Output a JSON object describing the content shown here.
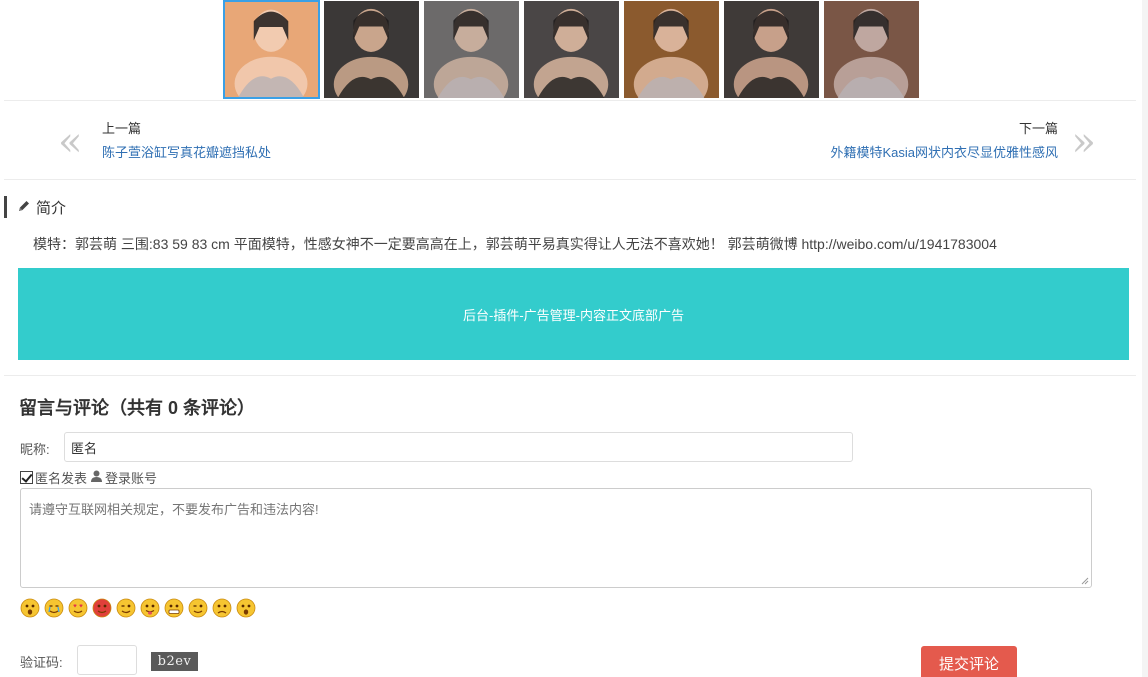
{
  "gallery": {
    "thumbnails": [
      {
        "alt": "photo-1",
        "bg": "#e8a777",
        "accent": "#f2cbb0",
        "active": true
      },
      {
        "alt": "photo-2",
        "bg": "#3b3837",
        "accent": "#c9a58c",
        "active": false
      },
      {
        "alt": "photo-3",
        "bg": "#6c6a6a",
        "accent": "#c7ad9c",
        "active": false
      },
      {
        "alt": "photo-4",
        "bg": "#4a4646",
        "accent": "#cfae98",
        "active": false
      },
      {
        "alt": "photo-5",
        "bg": "#8b5a2e",
        "accent": "#d9b299",
        "active": false
      },
      {
        "alt": "photo-6",
        "bg": "#3f3a38",
        "accent": "#c7a08a",
        "active": false
      },
      {
        "alt": "photo-7",
        "bg": "#7a5646",
        "accent": "#bfa7a0",
        "active": false
      }
    ]
  },
  "nav": {
    "prev_label": "上一篇",
    "prev_title": "陈子萱浴缸写真花瓣遮挡私处",
    "next_label": "下一篇",
    "next_title": "外籍模特Kasia网状内衣尽显优雅性感风",
    "prev_arrow": "«",
    "next_arrow": "»"
  },
  "intro": {
    "title": "简介",
    "icon": "pencil-icon",
    "text": "模特：郭芸萌 三围:83 59 83 cm 平面模特，性感女神不一定要高高在上，郭芸萌平易真实得让人无法不喜欢她！ 郭芸萌微博 http://weibo.com/u/1941783004"
  },
  "ad": {
    "text": "后台-插件-广告管理-内容正文底部广告",
    "color": "#33cccc"
  },
  "comments": {
    "title": "留言与评论（共有 0 条评论）",
    "nickname_label": "昵称:",
    "nickname_value": "匿名",
    "anonymous_label": "匿名发表",
    "anonymous_checked": true,
    "login_label": "登录账号",
    "login_icon": "user-icon",
    "textarea_placeholder": "请遵守互联网相关规定，不要发布广告和违法内容!",
    "emojis": [
      "surprised",
      "crying",
      "love-eyes",
      "angry",
      "smirk",
      "tongue",
      "grin",
      "wink",
      "sad",
      "yawn"
    ],
    "captcha_label": "验证码:",
    "captcha_text": "b2ev",
    "submit_label": "提交评论",
    "submit_color": "#e45a4d"
  }
}
